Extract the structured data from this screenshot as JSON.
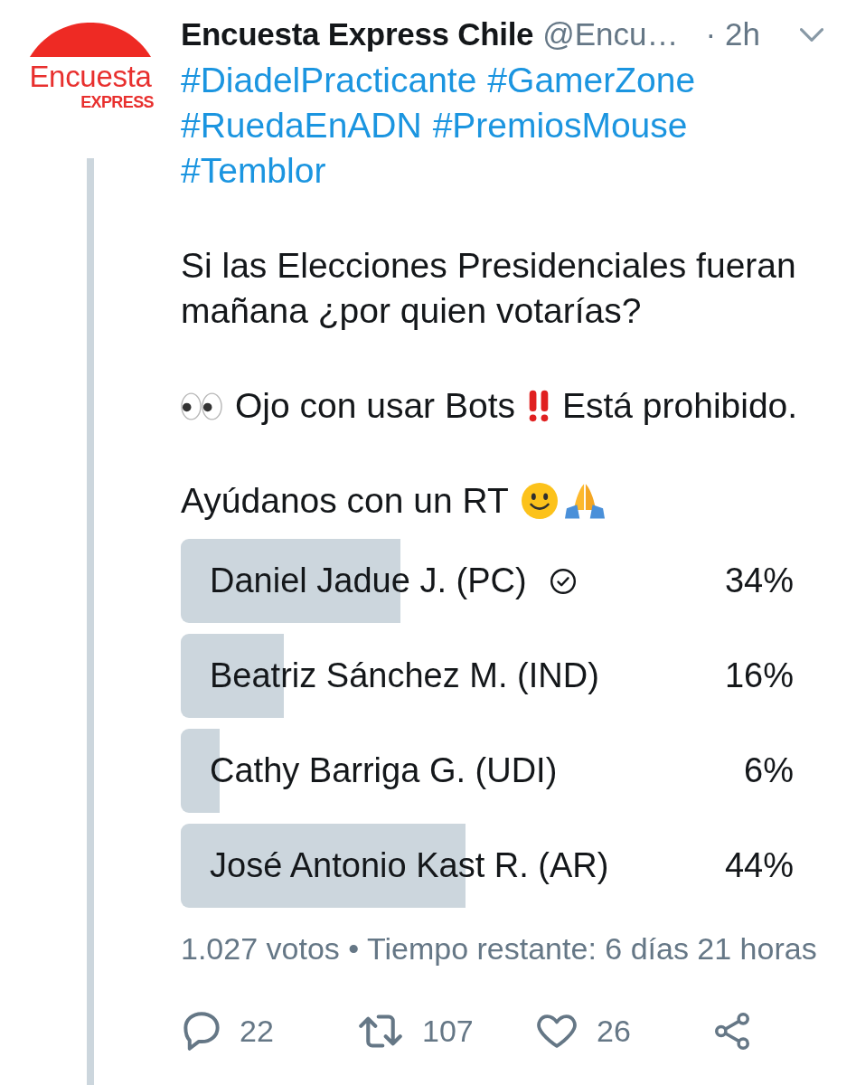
{
  "avatar": {
    "line_1": "Encuesta",
    "line_2": "EXPRESS"
  },
  "tweet_header": {
    "name": "Encuesta Express Chile",
    "handle": "@Encu…",
    "time": "· 2h"
  },
  "hashtag_lines": [
    [
      "#DiadelPracticante",
      "#GamerZone"
    ],
    [
      "#RuedaEnADN",
      "#PremiosMouse"
    ],
    [
      "#Temblor"
    ]
  ],
  "paragraphs": [
    {
      "segments": [
        {
          "kind": "text",
          "text": "Si las Elecciones Presidenciales fueran mañana ¿por quien votarías?"
        }
      ]
    },
    {
      "segments": [
        {
          "kind": "eyes"
        },
        {
          "kind": "text",
          "text": "Ojo con usar Bots"
        },
        {
          "kind": "exclamation"
        },
        {
          "kind": "text",
          "text": "Está prohibido."
        }
      ]
    },
    {
      "segments": [
        {
          "kind": "text",
          "text": "Ayúdanos con un RT"
        },
        {
          "kind": "smile"
        },
        {
          "kind": "pray"
        }
      ]
    }
  ],
  "poll": {
    "options": [
      {
        "label": "Daniel Jadue J. (PC)",
        "voted": true,
        "level": 0.34,
        "percentage": "34%"
      },
      {
        "label": "Beatriz Sánchez M. (IND)",
        "voted": false,
        "level": 0.16,
        "percentage": "16%"
      },
      {
        "label": "Cathy Barriga G. (UDI)",
        "voted": false,
        "level": 0.06,
        "percentage": "6%"
      },
      {
        "label": "José Antonio Kast R. (AR)",
        "voted": false,
        "level": 0.44,
        "percentage": "44%"
      }
    ],
    "summary": "1.027 votos • Tiempo restante: 6 días 21 horas"
  },
  "actions": [
    {
      "kind": "reply",
      "count": "22"
    },
    {
      "kind": "retweet",
      "count": "107"
    },
    {
      "kind": "like",
      "count": "26"
    },
    {
      "kind": "share"
    }
  ]
}
